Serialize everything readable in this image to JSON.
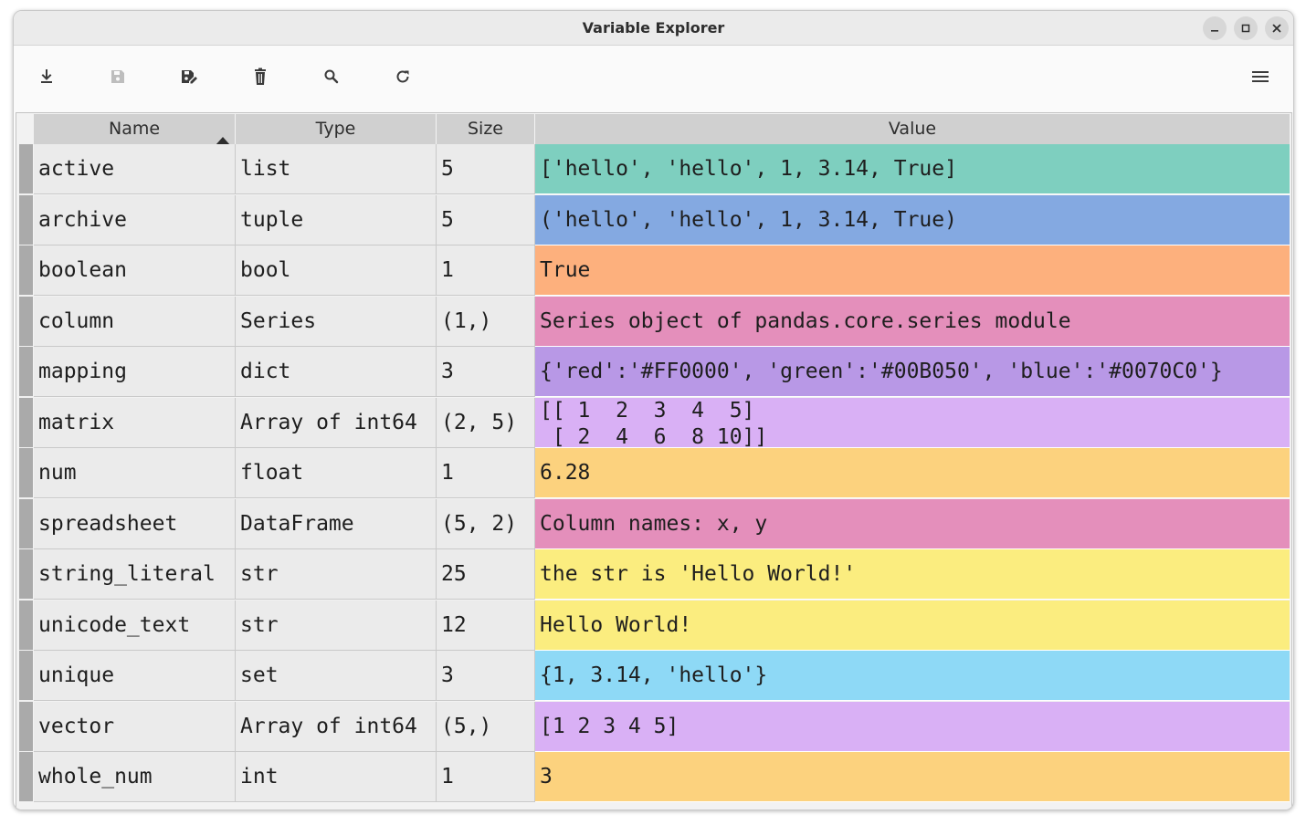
{
  "window": {
    "title": "Variable Explorer"
  },
  "titlebar_buttons": [
    {
      "name": "minimize-icon",
      "glyph": "–"
    },
    {
      "name": "maximize-icon",
      "glyph": "□"
    },
    {
      "name": "close-icon",
      "glyph": "✕"
    }
  ],
  "toolbar": {
    "buttons": [
      {
        "name": "import-data-icon",
        "enabled": true
      },
      {
        "name": "save-data-icon",
        "enabled": false
      },
      {
        "name": "save-data-as-icon",
        "enabled": true
      },
      {
        "name": "remove-all-icon",
        "enabled": true
      },
      {
        "name": "search-icon",
        "enabled": true
      },
      {
        "name": "refresh-icon",
        "enabled": true
      }
    ],
    "menu_icon": "hamburger-menu-icon"
  },
  "table": {
    "headers": {
      "name": "Name",
      "type": "Type",
      "size": "Size",
      "value": "Value"
    },
    "sort": {
      "column": "name",
      "direction": "ascending"
    },
    "rows": [
      {
        "name": "active",
        "type": "list",
        "size": "5",
        "value": "['hello', 'hello', 1, 3.14, True]",
        "color": "#7ecfbf"
      },
      {
        "name": "archive",
        "type": "tuple",
        "size": "5",
        "value": "('hello', 'hello', 1, 3.14, True)",
        "color": "#84a9e1"
      },
      {
        "name": "boolean",
        "type": "bool",
        "size": "1",
        "value": "True",
        "color": "#fdb07d"
      },
      {
        "name": "column",
        "type": "Series",
        "size": "(1,)",
        "value": "Series object of pandas.core.series module",
        "color": "#e48fbb"
      },
      {
        "name": "mapping",
        "type": "dict",
        "size": "3",
        "value": "{'red':'#FF0000', 'green':'#00B050', 'blue':'#0070C0'}",
        "color": "#b898e6"
      },
      {
        "name": "matrix",
        "type": "Array of int64",
        "size": "(2, 5)",
        "value": "[[ 1  2  3  4  5]\n [ 2  4  6  8 10]]",
        "color": "#d9b0f5"
      },
      {
        "name": "num",
        "type": "float",
        "size": "1",
        "value": "6.28",
        "color": "#fcd27e"
      },
      {
        "name": "spreadsheet",
        "type": "DataFrame",
        "size": "(5, 2)",
        "value": "Column names: x, y",
        "color": "#e48fbb"
      },
      {
        "name": "string_literal",
        "type": "str",
        "size": "25",
        "value": "the str is 'Hello World!'",
        "color": "#fbed7f"
      },
      {
        "name": "unicode_text",
        "type": "str",
        "size": "12",
        "value": "Hello World!",
        "color": "#fbed7f"
      },
      {
        "name": "unique",
        "type": "set",
        "size": "3",
        "value": "{1, 3.14, 'hello'}",
        "color": "#8ed9f6"
      },
      {
        "name": "vector",
        "type": "Array of int64",
        "size": "(5,)",
        "value": "[1 2 3 4 5]",
        "color": "#d9b0f5"
      },
      {
        "name": "whole_num",
        "type": "int",
        "size": "1",
        "value": "3",
        "color": "#fcd27e"
      }
    ]
  }
}
